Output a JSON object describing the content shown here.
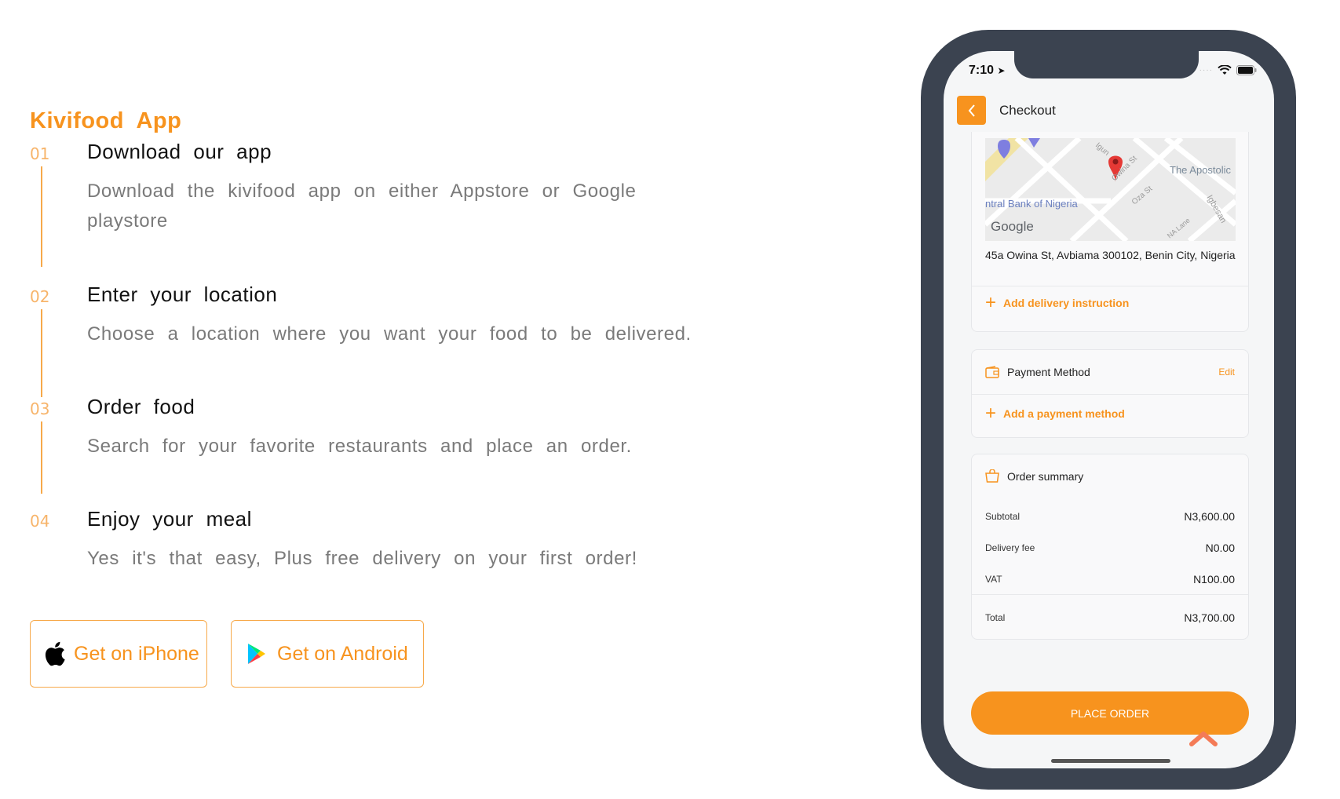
{
  "brand": {
    "name": "Kivifood  App",
    "color": "#F7931E"
  },
  "steps": [
    {
      "num": "01",
      "title": "Download  our  app",
      "desc": "Download  the  kivifood  app  on  either  Appstore  or  Google  playstore"
    },
    {
      "num": "02",
      "title": "Enter  your  location",
      "desc": "Choose  a  location  where  you  want  your  food  to  be  delivered."
    },
    {
      "num": "03",
      "title": "Order  food",
      "desc": "Search  for  your  favorite  restaurants  and  place  an  order."
    },
    {
      "num": "04",
      "title": "Enjoy  your  meal",
      "desc": "Yes  it's  that  easy,  Plus  free  delivery  on  your  first  order!"
    }
  ],
  "buttons": {
    "iphone": "Get on iPhone",
    "android": "Get on Android"
  },
  "phone": {
    "time": "7:10",
    "header_title": "Checkout",
    "map_labels": {
      "apostolic": "The Apostolic",
      "bank": "ntral Bank of Nigeria",
      "google": "Google",
      "igun": "Igun",
      "owina": "Owina St",
      "oza": "Oza St",
      "igbesan": "Igbesan",
      "lane": "NA Lane"
    },
    "address": "45a Owina St, Avbiama 300102, Benin City, Nigeria",
    "add_instruction": "Add delivery instruction",
    "payment": {
      "title": "Payment Method",
      "edit": "Edit",
      "add": "Add a payment method"
    },
    "summary": {
      "title": "Order summary",
      "rows": [
        {
          "label": "Subtotal",
          "value": "N3,600.00"
        },
        {
          "label": "Delivery fee",
          "value": "N0.00"
        },
        {
          "label": "VAT",
          "value": "N100.00"
        }
      ],
      "total": {
        "label": "Total",
        "value": "N3,700.00"
      }
    },
    "place_order": "PLACE ORDER"
  }
}
